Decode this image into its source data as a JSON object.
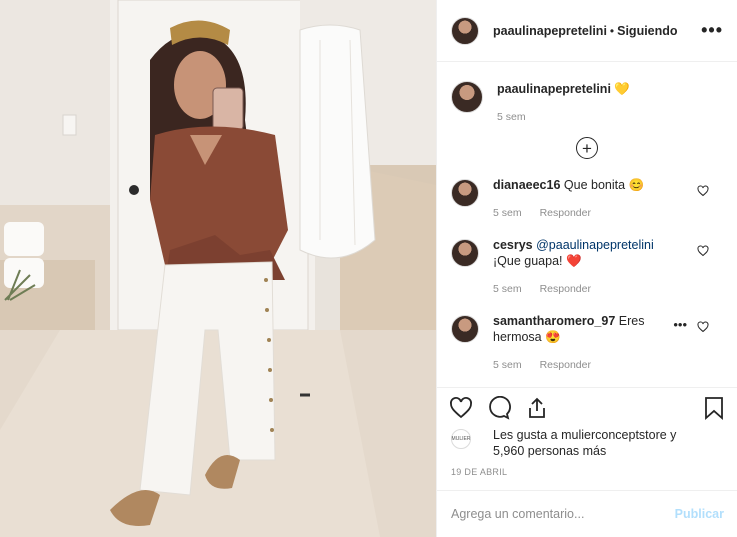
{
  "header": {
    "username": "paaulinapepretelini",
    "separator": "•",
    "follow_status": "Siguiendo",
    "more_label": "•••"
  },
  "caption": {
    "username": "paaulinapepretelini",
    "emoji": "💛",
    "time": "5 sem"
  },
  "comments": [
    {
      "username": "dianaeec16",
      "text": "Que bonita 😊",
      "time": "5 sem",
      "reply": "Responder"
    },
    {
      "username": "cesrys",
      "mention": "@paaulinapepretelini",
      "text": " ¡Que guapa! ❤️",
      "time": "5 sem",
      "reply": "Responder"
    },
    {
      "username": "samantharomero_97",
      "text": "Eres hermosa 😍",
      "time": "5 sem",
      "reply": "Responder",
      "more": "•••"
    }
  ],
  "likes": {
    "avatar_label": "MULIER",
    "line1": "Les gusta a mulierconceptstore y",
    "line2": "5,960 personas más"
  },
  "date": "19 DE ABRIL",
  "add_comment": {
    "placeholder": "Agrega un comentario...",
    "publish": "Publicar"
  },
  "icons": [
    "heart-icon",
    "comment-icon",
    "share-icon",
    "bookmark-icon",
    "add-circle-icon"
  ]
}
